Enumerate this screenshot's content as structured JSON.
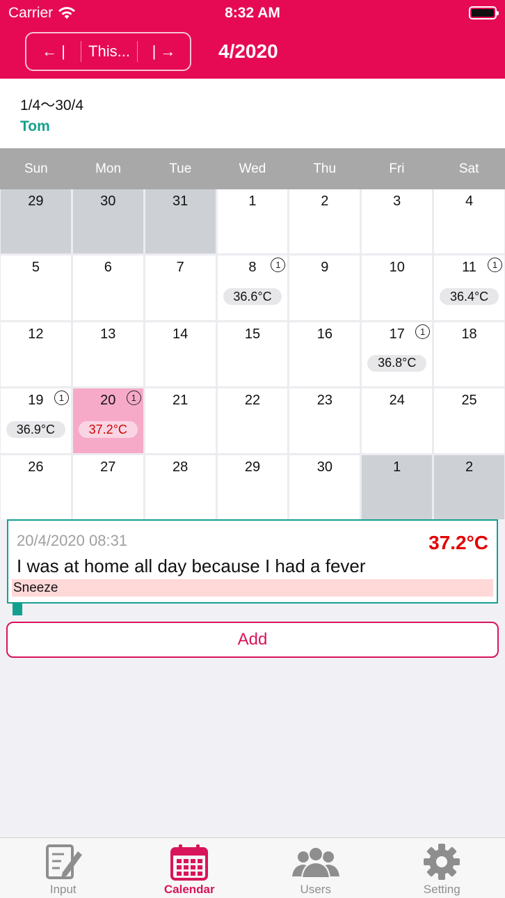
{
  "status": {
    "carrier": "Carrier",
    "time": "8:32 AM"
  },
  "nav": {
    "prev": "← |",
    "this": "This...",
    "next": "| →",
    "title": "4/2020"
  },
  "info": {
    "range": "1/4～30/4",
    "user": "Tom"
  },
  "weekdays": [
    "Sun",
    "Mon",
    "Tue",
    "Wed",
    "Thu",
    "Fri",
    "Sat"
  ],
  "days": [
    {
      "day": "29",
      "outside": true
    },
    {
      "day": "30",
      "outside": true
    },
    {
      "day": "31",
      "outside": true
    },
    {
      "day": "1"
    },
    {
      "day": "2"
    },
    {
      "day": "3"
    },
    {
      "day": "4"
    },
    {
      "day": "5"
    },
    {
      "day": "6"
    },
    {
      "day": "7"
    },
    {
      "day": "8",
      "badge": "1",
      "temp": "36.6°C"
    },
    {
      "day": "9"
    },
    {
      "day": "10"
    },
    {
      "day": "11",
      "badge": "1",
      "temp": "36.4°C"
    },
    {
      "day": "12"
    },
    {
      "day": "13"
    },
    {
      "day": "14"
    },
    {
      "day": "15"
    },
    {
      "day": "16"
    },
    {
      "day": "17",
      "badge": "1",
      "temp": "36.8°C"
    },
    {
      "day": "18"
    },
    {
      "day": "19",
      "badge": "1",
      "temp": "36.9°C"
    },
    {
      "day": "20",
      "badge": "1",
      "temp": "37.2°C",
      "selected": true
    },
    {
      "day": "21"
    },
    {
      "day": "22"
    },
    {
      "day": "23"
    },
    {
      "day": "24"
    },
    {
      "day": "25"
    },
    {
      "day": "26"
    },
    {
      "day": "27"
    },
    {
      "day": "28"
    },
    {
      "day": "29"
    },
    {
      "day": "30"
    },
    {
      "day": "1",
      "outside": true
    },
    {
      "day": "2",
      "outside": true
    }
  ],
  "record": {
    "datetime": "20/4/2020 08:31",
    "temp": "37.2°C",
    "note": "I was at home all day because I had a fever",
    "tag": "Sneeze"
  },
  "add_label": "Add",
  "tabs": [
    {
      "label": "Input",
      "icon": "input-icon"
    },
    {
      "label": "Calendar",
      "icon": "calendar-icon",
      "active": true
    },
    {
      "label": "Users",
      "icon": "users-icon"
    },
    {
      "label": "Setting",
      "icon": "gear-icon"
    }
  ],
  "colors": {
    "primary": "#e60a55",
    "accent": "#14a08e",
    "alert": "#e50000"
  }
}
